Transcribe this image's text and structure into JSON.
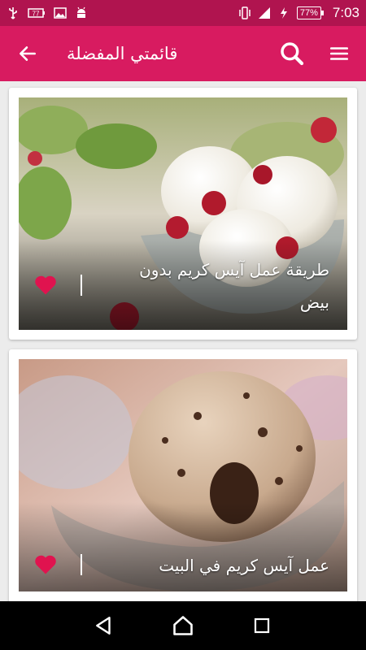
{
  "status_bar": {
    "battery": "77%",
    "time": "7:03",
    "color": "#b0144f"
  },
  "app_bar": {
    "title": "قائمتي المفضلة",
    "color": "#d81b60",
    "back_icon": "arrow-left-icon",
    "search_icon": "search-icon",
    "menu_icon": "hamburger-menu-icon"
  },
  "favorites": [
    {
      "title": "طريقة عمل آيس كريم بدون بيض",
      "favorite": true,
      "image": "vanilla-ice-cream-with-raspberries"
    },
    {
      "title": "عمل آيس كريم في البيت",
      "favorite": true,
      "image": "chocolate-chip-ice-cream-scoop"
    }
  ],
  "heart_color": "#e0134f",
  "nav_bar": {
    "back_icon": "triangle-back-icon",
    "home_icon": "home-icon",
    "recents_icon": "square-recents-icon"
  }
}
